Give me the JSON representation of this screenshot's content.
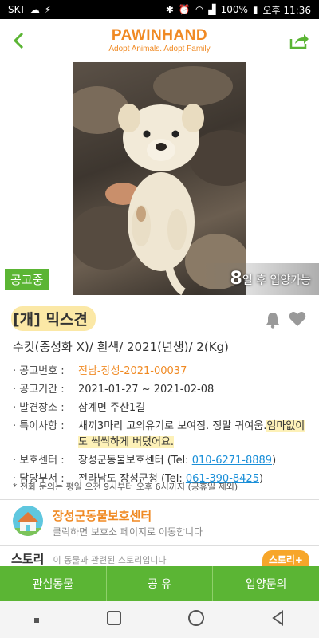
{
  "status_bar": {
    "carrier": "SKT",
    "battery": "100%",
    "time": "오후 11:36"
  },
  "header": {
    "logo_main": "PAWINHAND",
    "logo_sub": "Adopt Animals. Adopt Family"
  },
  "photo": {
    "status_badge": "공고중",
    "days_number": "8",
    "days_suffix": "일 후 입양가능"
  },
  "animal": {
    "title": "[개] 믹스견",
    "summary": "수컷(중성화 X)/ 흰색/ 2021(년생)/ 2(Kg)"
  },
  "info": {
    "notice_no_label": "공고번호 :",
    "notice_no": "전남-장성-2021-00037",
    "period_label": "공고기간 :",
    "period": "2021-01-27 ~ 2021-02-08",
    "found_label": "발견장소 :",
    "found": "삼계면 주산1길",
    "special_label": "특이사항 :",
    "special_a": "새끼3마리 고의유기로 보여짐. 정말 귀여움.",
    "special_b": "엄마없이도 씩씩하게 버텼어요.",
    "shelter_label": "보호센터 :",
    "shelter_name": "장성군동물보호센터 (Tel: ",
    "shelter_tel": "010-6271-8889",
    "shelter_close": ")",
    "dept_label": "담당부서 :",
    "dept_name": "전라남도 장성군청 (Tel: ",
    "dept_tel": "061-390-8425",
    "dept_close": ")",
    "note": "* 전화 문의는 평일 오전 9시부터 오후 6시까지 (공휴일 제외)"
  },
  "center": {
    "name": "장성군동물보호센터",
    "sub": "클릭하면 보호소 페이지로 이동합니다"
  },
  "story": {
    "title": "스토리",
    "desc": "이 동물과 관련된 스토리입니다",
    "button": "스토리+"
  },
  "tabs": [
    "관심동물",
    "공 유",
    "입양문의"
  ],
  "colors": {
    "brand_green": "#5bb534",
    "brand_orange": "#f08a24",
    "highlight_yellow": "#fbe8a6"
  }
}
